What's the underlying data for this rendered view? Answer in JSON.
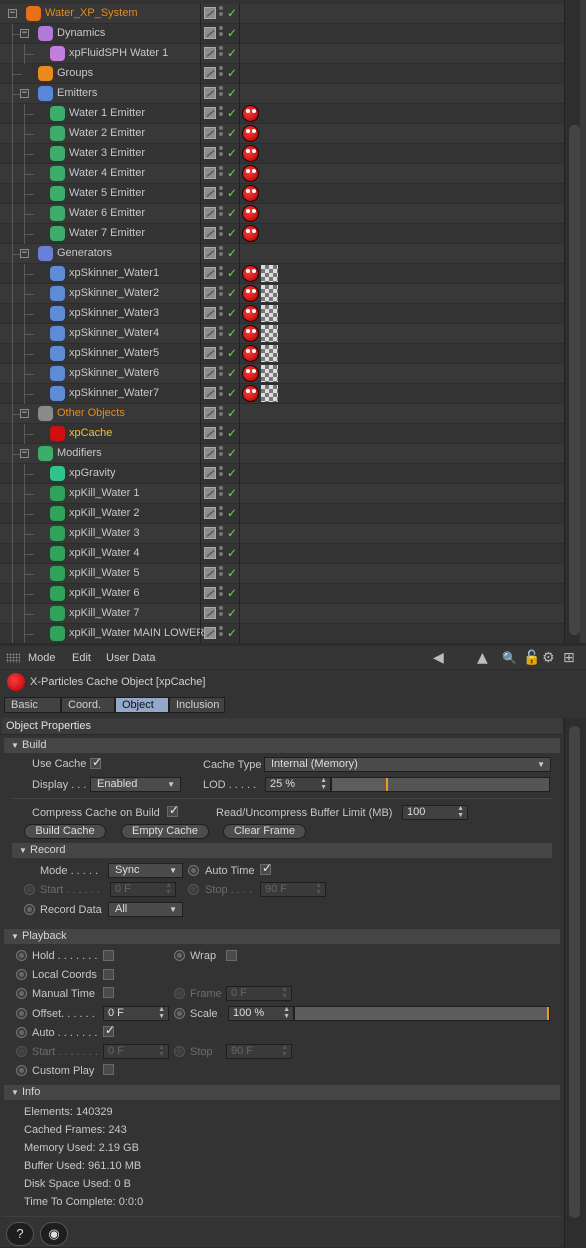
{
  "object_manager": {
    "rows": [
      {
        "name": "Water_XP_System",
        "depth": 0,
        "fold": "⊟",
        "icon": "xp-system-icon",
        "icon_color": "#e8701a",
        "color": "orange",
        "tags": []
      },
      {
        "name": "Dynamics",
        "depth": 1,
        "fold": "⊟",
        "icon": "dynamics-group-icon",
        "icon_color": "#b07ad8",
        "color": "normal",
        "tags": []
      },
      {
        "name": "xpFluidSPH Water 1",
        "depth": 2,
        "fold": "",
        "icon": "fluid-icon",
        "icon_color": "#c27fe0",
        "color": "normal",
        "tags": []
      },
      {
        "name": "Groups",
        "depth": 1,
        "fold": "",
        "icon": "groups-icon",
        "icon_color": "#e88a1c",
        "color": "normal",
        "tags": []
      },
      {
        "name": "Emitters",
        "depth": 1,
        "fold": "⊟",
        "icon": "emitters-group-icon",
        "icon_color": "#5a87d8",
        "color": "normal",
        "tags": []
      },
      {
        "name": "Water 1 Emitter",
        "depth": 2,
        "fold": "",
        "icon": "emitter-icon",
        "icon_color": "#3cae6a",
        "color": "normal",
        "tags": [
          "red"
        ]
      },
      {
        "name": "Water 2 Emitter",
        "depth": 2,
        "fold": "",
        "icon": "emitter-icon",
        "icon_color": "#3cae6a",
        "color": "normal",
        "tags": [
          "red"
        ]
      },
      {
        "name": "Water 3 Emitter",
        "depth": 2,
        "fold": "",
        "icon": "emitter-icon",
        "icon_color": "#3cae6a",
        "color": "normal",
        "tags": [
          "red"
        ]
      },
      {
        "name": "Water 4 Emitter",
        "depth": 2,
        "fold": "",
        "icon": "emitter-icon",
        "icon_color": "#3cae6a",
        "color": "normal",
        "tags": [
          "red"
        ]
      },
      {
        "name": "Water 5 Emitter",
        "depth": 2,
        "fold": "",
        "icon": "emitter-icon",
        "icon_color": "#3cae6a",
        "color": "normal",
        "tags": [
          "red"
        ]
      },
      {
        "name": "Water 6 Emitter",
        "depth": 2,
        "fold": "",
        "icon": "emitter-icon",
        "icon_color": "#3cae6a",
        "color": "normal",
        "tags": [
          "red"
        ]
      },
      {
        "name": "Water 7 Emitter",
        "depth": 2,
        "fold": "",
        "icon": "emitter-icon",
        "icon_color": "#3cae6a",
        "color": "normal",
        "tags": [
          "red"
        ]
      },
      {
        "name": "Generators",
        "depth": 1,
        "fold": "⊟",
        "icon": "generators-group-icon",
        "icon_color": "#6a7fd6",
        "color": "normal",
        "tags": []
      },
      {
        "name": "xpSkinner_Water1",
        "depth": 2,
        "fold": "",
        "icon": "skinner-icon",
        "icon_color": "#5f8ad6",
        "color": "normal",
        "tags": [
          "red",
          "checker"
        ]
      },
      {
        "name": "xpSkinner_Water2",
        "depth": 2,
        "fold": "",
        "icon": "skinner-icon",
        "icon_color": "#5f8ad6",
        "color": "normal",
        "tags": [
          "red",
          "checker"
        ]
      },
      {
        "name": "xpSkinner_Water3",
        "depth": 2,
        "fold": "",
        "icon": "skinner-icon",
        "icon_color": "#5f8ad6",
        "color": "normal",
        "tags": [
          "red",
          "checker"
        ]
      },
      {
        "name": "xpSkinner_Water4",
        "depth": 2,
        "fold": "",
        "icon": "skinner-icon",
        "icon_color": "#5f8ad6",
        "color": "normal",
        "tags": [
          "red",
          "checker"
        ]
      },
      {
        "name": "xpSkinner_Water5",
        "depth": 2,
        "fold": "",
        "icon": "skinner-icon",
        "icon_color": "#5f8ad6",
        "color": "normal",
        "tags": [
          "red",
          "checker"
        ]
      },
      {
        "name": "xpSkinner_Water6",
        "depth": 2,
        "fold": "",
        "icon": "skinner-icon",
        "icon_color": "#5f8ad6",
        "color": "normal",
        "tags": [
          "red",
          "checker"
        ]
      },
      {
        "name": "xpSkinner_Water7",
        "depth": 2,
        "fold": "",
        "icon": "skinner-icon",
        "icon_color": "#5f8ad6",
        "color": "normal",
        "tags": [
          "red",
          "checker"
        ]
      },
      {
        "name": "Other Objects",
        "depth": 1,
        "fold": "⊟",
        "icon": "other-objects-group-icon",
        "icon_color": "#8a8a8a",
        "color": "orange",
        "tags": []
      },
      {
        "name": "xpCache",
        "depth": 2,
        "fold": "",
        "icon": "cache-icon",
        "icon_color": "#d01010",
        "color": "yellow",
        "tags": []
      },
      {
        "name": "Modifiers",
        "depth": 1,
        "fold": "⊟",
        "icon": "modifiers-group-icon",
        "icon_color": "#3cae6a",
        "color": "normal",
        "tags": []
      },
      {
        "name": "xpGravity",
        "depth": 2,
        "fold": "",
        "icon": "gravity-icon",
        "icon_color": "#2fc48a",
        "color": "normal",
        "tags": []
      },
      {
        "name": "xpKill_Water 1",
        "depth": 2,
        "fold": "",
        "icon": "kill-icon",
        "icon_color": "#2fa35a",
        "color": "normal",
        "tags": []
      },
      {
        "name": "xpKill_Water 2",
        "depth": 2,
        "fold": "",
        "icon": "kill-icon",
        "icon_color": "#2fa35a",
        "color": "normal",
        "tags": []
      },
      {
        "name": "xpKill_Water 3",
        "depth": 2,
        "fold": "",
        "icon": "kill-icon",
        "icon_color": "#2fa35a",
        "color": "normal",
        "tags": []
      },
      {
        "name": "xpKill_Water 4",
        "depth": 2,
        "fold": "",
        "icon": "kill-icon",
        "icon_color": "#2fa35a",
        "color": "normal",
        "tags": []
      },
      {
        "name": "xpKill_Water 5",
        "depth": 2,
        "fold": "",
        "icon": "kill-icon",
        "icon_color": "#2fa35a",
        "color": "normal",
        "tags": []
      },
      {
        "name": "xpKill_Water 6",
        "depth": 2,
        "fold": "",
        "icon": "kill-icon",
        "icon_color": "#2fa35a",
        "color": "normal",
        "tags": []
      },
      {
        "name": "xpKill_Water 7",
        "depth": 2,
        "fold": "",
        "icon": "kill-icon",
        "icon_color": "#2fa35a",
        "color": "normal",
        "tags": []
      },
      {
        "name": "xpKill_Water MAIN LOWER",
        "depth": 2,
        "fold": "",
        "icon": "kill-icon",
        "icon_color": "#2fa35a",
        "color": "normal",
        "tags": []
      }
    ],
    "check_glyph": "✓"
  },
  "attribute_manager": {
    "menu": {
      "mode": "Mode",
      "edit": "Edit",
      "user_data": "User Data"
    },
    "toolbar_icons": [
      "back-arrow-icon",
      "up-arrow-icon",
      "search-icon",
      "lock-icon",
      "settings-icon",
      "new-panel-icon"
    ],
    "toolbar_glyphs": [
      "◀",
      "▲",
      "🔍",
      "🔓",
      "⚙",
      "⊞"
    ],
    "title": "X-Particles Cache Object [xpCache]",
    "tabs": [
      "Basic",
      "Coord.",
      "Object",
      "Inclusion"
    ],
    "active_tab": "Object",
    "object_properties": "Object Properties",
    "build": {
      "header": "Build",
      "use_cache_label": "Use Cache",
      "use_cache": true,
      "cache_type_label": "Cache Type",
      "cache_type_value": "Internal (Memory)",
      "display_label": "Display . . .",
      "display_value": "Enabled",
      "lod_label": "LOD . . . . .",
      "lod_value": "25 %",
      "lod_fraction": 0.25,
      "compress_label": "Compress Cache on Build",
      "compress": true,
      "buffer_label": "Read/Uncompress Buffer Limit (MB)",
      "buffer_value": "100",
      "build_cache": "Build Cache",
      "empty_cache": "Empty Cache",
      "clear_frame": "Clear Frame"
    },
    "record": {
      "header": "Record",
      "mode_label": "Mode . . . . .",
      "mode_value": "Sync",
      "auto_time_label": "Auto Time",
      "auto_time": true,
      "start_label": "Start . . . . . .",
      "start_value": "0 F",
      "stop_label": "Stop . . . .",
      "stop_value": "90 F",
      "record_data_label": "Record Data",
      "record_data_value": "All"
    },
    "playback": {
      "header": "Playback",
      "hold_label": "Hold . . . . . . .",
      "wrap_label": "Wrap",
      "local_coords_label": "Local Coords",
      "manual_time_label": "Manual Time",
      "frame_label": "Frame",
      "frame_value": "0 F",
      "offset_label": "Offset. . . . . .",
      "offset_value": "0 F",
      "scale_label": "Scale",
      "scale_value": "100 %",
      "scale_fraction": 1.0,
      "auto_label": "Auto . . . . . . .",
      "auto": true,
      "start_label": "Start . . . . . . .",
      "start_value": "0 F",
      "stop_label": "Stop",
      "stop_value": "90 F",
      "custom_play_label": "Custom Play"
    },
    "info": {
      "header": "Info",
      "elements": "Elements: 140329",
      "cached_frames": "Cached Frames: 243",
      "memory_used": "Memory Used: 2.19 GB",
      "buffer_used": "Buffer Used: 961.10 MB",
      "disk_space": "Disk Space Used: 0 B",
      "time_to_complete": "Time To Complete: 0:0:0"
    },
    "bottom_icons": [
      "help-icon",
      "camera-icon"
    ]
  },
  "colors": {
    "accent_orange": "#e88a1c",
    "active_tab": "#94a9c9",
    "check_green": "#6fd44a",
    "tag_red": "#d01010"
  }
}
